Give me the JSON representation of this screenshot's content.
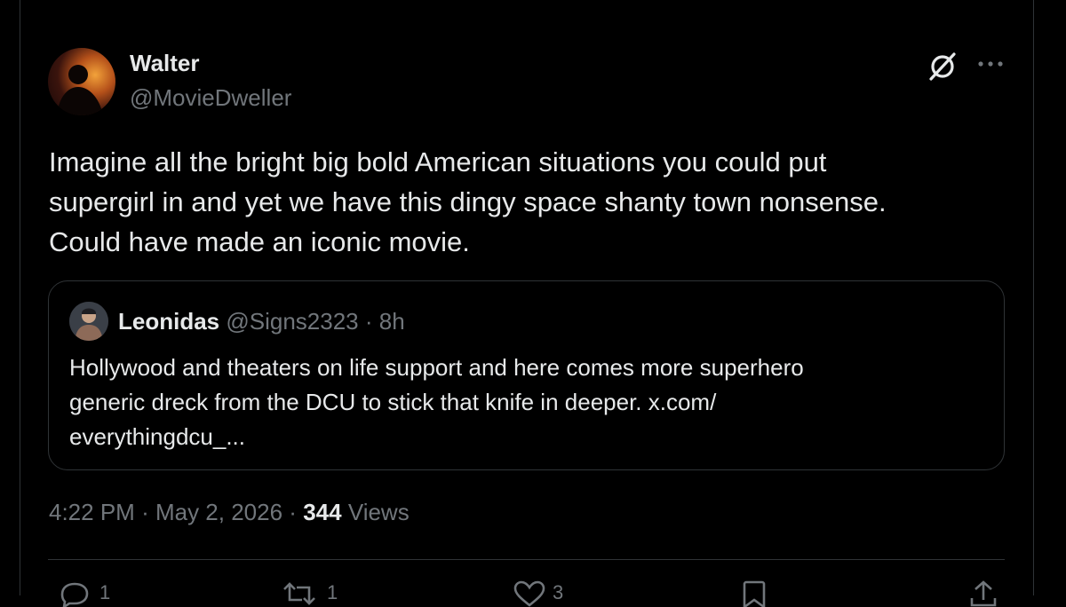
{
  "author": {
    "display_name": "Walter",
    "handle": "@MovieDweller",
    "avatar_icon": "avatar-silhouette-icon"
  },
  "tweet": {
    "text": "Imagine all the bright big bold American situations you could put\nsupergirl in and yet we have this dingy space shanty town nonsense.\nCould have made an iconic movie."
  },
  "quote": {
    "display_name": "Leonidas",
    "handle": "@Signs2323",
    "separator": "·",
    "time": "8h",
    "text": "Hollywood and theaters on life support and here comes more superhero\ngeneric dreck from the DCU to stick that knife in deeper. x.com/\neverythingdcu_..."
  },
  "meta": {
    "time": "4:22 PM",
    "sep1": "·",
    "date": "May 2, 2026",
    "sep2": "·",
    "views_count": "344",
    "views_label": "Views"
  },
  "actions": {
    "reply_count": "1",
    "repost_count": "1",
    "like_count": "3"
  },
  "colors": {
    "background": "#000000",
    "text_primary": "#e7e9ea",
    "text_secondary": "#71767b",
    "border": "#2f3336"
  }
}
